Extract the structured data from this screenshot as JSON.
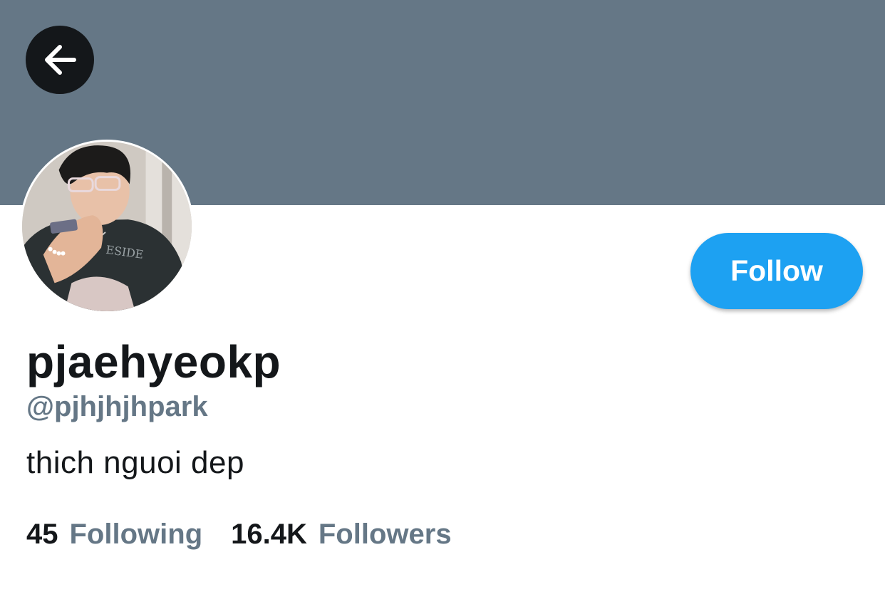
{
  "colors": {
    "banner": "#657786",
    "back_button_bg": "#14171a",
    "back_arrow": "#ffffff",
    "accent": "#1da1f2",
    "primary_text": "#14171a",
    "secondary_text": "#657786"
  },
  "header": {
    "back_icon": "arrow-left-icon"
  },
  "profile": {
    "avatar_alt": "profile photo",
    "display_name": "pjaehyeokp",
    "handle": "@pjhjhjhpark",
    "bio": "thich nguoi dep"
  },
  "actions": {
    "follow_label": "Follow"
  },
  "stats": {
    "following_count": "45",
    "following_label": "Following",
    "followers_count": "16.4K",
    "followers_label": "Followers"
  }
}
